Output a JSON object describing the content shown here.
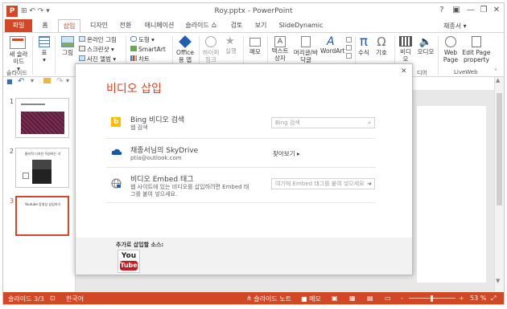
{
  "window": {
    "title": "Roy.pptx - PowerPoint",
    "app_icon": "P",
    "help": "?",
    "minimize": "—",
    "restore": "❐",
    "close": "✕",
    "user": "채종서 ▾"
  },
  "qat_top": "⊞ ↶ ↷ ▾",
  "tabs": {
    "file": "파일",
    "items": [
      "홈",
      "삽입",
      "디자인",
      "전환",
      "애니메이션",
      "슬라이드 쇼",
      "검토",
      "보기",
      "SlideDynamic"
    ],
    "active_index": 1
  },
  "ribbon": {
    "new_slide": "새 슬라이드",
    "new_slide_arrow": "▾",
    "table": "표",
    "table_arrow": "▾",
    "picture": "그림",
    "online_pictures": "온라인 그림",
    "screenshot": "스크린샷 ▾",
    "photo_album": "사진 앨범 ▾",
    "shapes": "도형 ▾",
    "smartart": "SmartArt",
    "chart": "차트",
    "office_apps": "Office용 앱",
    "hyperlink": "하이퍼링크",
    "action": "실행",
    "comment": "메모",
    "text_box": "텍스트 상자",
    "header_footer": "머리글/바닥글",
    "wordart": "WordArt",
    "equation": "수식",
    "symbol": "기호",
    "video": "비디오",
    "audio": "오디오",
    "web_page": "Web Page",
    "edit_page_property": "Edit Page property",
    "group_slides": "슬라이드",
    "group_media": "디어",
    "group_liveweb": "LiveWeb"
  },
  "qat_row": {
    "save": "💾",
    "undo": "↶",
    "open": "📂",
    "redo": "↷",
    "more": "▾"
  },
  "slides": [
    {
      "number": "1"
    },
    {
      "number": "2",
      "caption": "물리적 디자인 작성하는 거"
    },
    {
      "number": "3",
      "caption": "Youtube 동영상 삽입하기"
    }
  ],
  "dialog": {
    "title": "비디오 삽입",
    "close": "✕",
    "options": [
      {
        "title": "Bing 비디오 검색",
        "subtitle": "웹 검색",
        "placeholder": "Bing 검색",
        "action_icon": "⌕"
      },
      {
        "title": "채종서님의 SkyDrive",
        "subtitle": "ptia@outlook.com",
        "action": "찾아보기 ▸"
      },
      {
        "title": "비디오 Embed 태그",
        "subtitle_line1": "웹 사이트에 있는 비디오를 삽입하려면 Embed 태",
        "subtitle_line2": "그를 붙여 넣으세요.",
        "placeholder": "여기에 Embed 태그를 붙여 넣으세요",
        "action_icon": "➜"
      }
    ],
    "more_sources_label": "추가로 삽입할 소스:",
    "youtube_you": "You",
    "youtube_tube": "Tube"
  },
  "statusbar": {
    "slide_count": "슬라이드 3/3",
    "language": "한국어",
    "notes": "≜ 슬라이드 노트",
    "comments": "■ 메모",
    "zoom_minus": "-",
    "zoom_plus": "+",
    "zoom": "53 %",
    "fit": "⤢"
  },
  "colors": {
    "accent": "#d24726",
    "bing": "#ffb900",
    "skydrive": "#0f5ba8",
    "youtube_red": "#cc181e"
  }
}
